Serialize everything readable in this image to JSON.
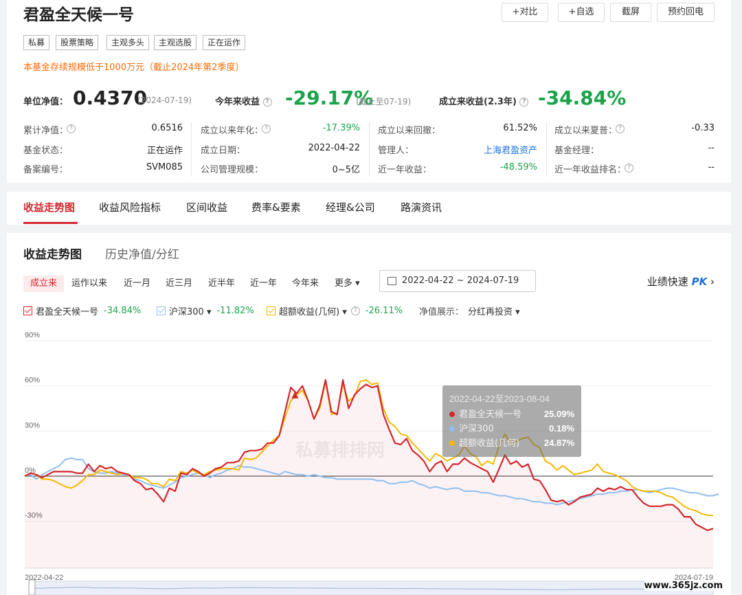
{
  "header": {
    "title": "君盈全天候一号",
    "buttons": [
      "+对比",
      "+自选",
      "截屏",
      "预约回电"
    ],
    "tags": [
      "私募",
      "股票策略",
      "主观多头",
      "主观选股",
      "正在运作"
    ],
    "notice": "本基金存续规模低于1000万元（截止2024年第2季度）"
  },
  "metrics": {
    "nav_label": "单位净值：",
    "nav_value": "0.4370",
    "nav_date": "(2024-07-19)",
    "ytd_label": "今年来收益",
    "ytd_value": "-29.17%",
    "ytd_note": "(截止至07-19)",
    "since_label": "成立来收益(2.3年)",
    "since_value": "-34.84%"
  },
  "details": [
    [
      {
        "label": "累计净值：",
        "value": "0.6516",
        "help": true
      },
      {
        "label": "成立以来年化：",
        "value": "-17.39%",
        "help": true,
        "color": "#1aa34a"
      },
      {
        "label": "成立以来回撤：",
        "value": "61.52%"
      },
      {
        "label": "成立以来夏普：",
        "value": "-0.33",
        "help": true
      }
    ],
    [
      {
        "label": "基金状态：",
        "value": "正在运作"
      },
      {
        "label": "成立日期：",
        "value": "2022-04-22"
      },
      {
        "label": "管理人：",
        "value": "上海君盈资产",
        "color": "#1e6fd9"
      },
      {
        "label": "基金经理：",
        "value": "--"
      }
    ],
    [
      {
        "label": "备案编号：",
        "value": "SVM085"
      },
      {
        "label": "公司管理规模：",
        "value": "0~5亿"
      },
      {
        "label": "近一年收益：",
        "value": "-48.59%",
        "color": "#1aa34a"
      },
      {
        "label": "近一年收益排名：",
        "value": "--",
        "help": true
      }
    ]
  ],
  "tabs": [
    "收益走势图",
    "收益风险指标",
    "区间收益",
    "费率&要素",
    "经理&公司",
    "路演资讯"
  ],
  "chart_section": {
    "title": "收益走势图",
    "alt_title": "历史净值/分红",
    "ranges": [
      "成立来",
      "运作以来",
      "近一月",
      "近三月",
      "近半年",
      "近一年",
      "今年来",
      "更多 ▾"
    ],
    "date_range": "2022-04-22 ~ 2024-07-19",
    "pk_label": "业绩快速",
    "pk_brand": "PK",
    "legend": [
      {
        "name": "君盈全天候一号",
        "value": "-34.84%",
        "color": "#d3262d"
      },
      {
        "name": "沪深300 ▾",
        "value": "-11.82%",
        "color": "#8fbff0"
      },
      {
        "name": "超额收益(几何) ▾",
        "value": "-26.11%",
        "color": "#f5b800"
      }
    ],
    "nav_display_label": "净值展示：",
    "nav_display_value": "分红再投资 ▾",
    "watermark": "www.365jz.com"
  },
  "chart_data": {
    "type": "line",
    "title": "",
    "x_start_label": "2022-04-22",
    "x_end_label": "2024-07-19",
    "yticks": [
      "90%",
      "60%",
      "30%",
      "0%",
      "-30%"
    ],
    "ylim": [
      -50,
      90
    ],
    "series": [
      {
        "name": "君盈全天候一号",
        "color": "#d3262d",
        "values": [
          0,
          2,
          1,
          -1,
          1,
          3,
          3,
          3,
          3,
          2,
          2,
          8,
          3,
          7,
          5,
          6,
          3,
          2,
          1,
          -3,
          -5,
          -9,
          -8,
          -12,
          -17,
          -8,
          -10,
          2,
          1,
          5,
          3,
          0,
          2,
          5,
          6,
          9,
          9,
          10,
          16,
          17,
          17,
          18,
          22,
          22,
          27,
          43,
          59,
          55,
          60,
          50,
          38,
          47,
          64,
          43,
          41,
          64,
          45,
          54,
          58,
          61,
          59,
          60,
          41,
          31,
          22,
          21,
          25,
          17,
          14,
          10,
          3,
          8,
          10,
          3,
          8,
          8,
          12,
          9,
          7,
          5,
          3,
          -4,
          5,
          14,
          8,
          10,
          6,
          8,
          -2,
          -3,
          -9,
          -16,
          -17,
          -16,
          -19,
          -17,
          -14,
          -13,
          -12,
          -8,
          -10,
          -8,
          -9,
          -7,
          -9,
          -9,
          -14,
          -18,
          -20,
          -20,
          -20,
          -19,
          -19,
          -22,
          -27,
          -27,
          -32,
          -34,
          -36,
          -34.84
        ]
      },
      {
        "name": "沪深300",
        "color": "#8fbff0",
        "values": [
          0,
          1,
          -2,
          1,
          3,
          5,
          7,
          11,
          12,
          11,
          11,
          5,
          3,
          2,
          2,
          3,
          2,
          1,
          1,
          -2,
          -3,
          -5,
          -6,
          -7,
          -8,
          -6,
          -4,
          -1,
          0,
          1,
          2,
          1,
          -1,
          1,
          2,
          4,
          5,
          7,
          6,
          6,
          5,
          4,
          3,
          2,
          1,
          3,
          2,
          1,
          1,
          0,
          1,
          0,
          -1,
          -1,
          -2,
          -2,
          -2,
          -2,
          -2,
          -2,
          -2,
          -3,
          -3,
          -5,
          -5,
          -4,
          -4,
          -3,
          -5,
          -6,
          -8,
          -7,
          -8,
          -9,
          -8,
          -8,
          -10,
          -10,
          -10,
          -11,
          -11,
          -12,
          -13,
          -13,
          -14,
          -15,
          -15,
          -16,
          -17,
          -17,
          -18,
          -18,
          -19,
          -18,
          -17,
          -16,
          -15,
          -14,
          -13,
          -12,
          -12,
          -11,
          -11,
          -10,
          -10,
          -9,
          -9,
          -10,
          -11,
          -10,
          -9,
          -8,
          -8,
          -9,
          -10,
          -11,
          -11,
          -12,
          -13,
          -13,
          -11.82
        ]
      },
      {
        "name": "超额收益(几何)",
        "color": "#f5b800",
        "values": [
          0,
          2,
          1,
          -2,
          -2,
          -3,
          -5,
          -7,
          -8,
          -6,
          -3,
          1,
          1,
          4,
          3,
          2,
          1,
          2,
          1,
          -1,
          -1,
          -2,
          -5,
          -5,
          -7,
          -2,
          -3,
          3,
          2,
          4,
          2,
          1,
          3,
          4,
          5,
          5,
          5,
          4,
          12,
          11,
          12,
          16,
          20,
          24,
          27,
          39,
          50,
          54,
          57,
          50,
          38,
          45,
          63,
          41,
          42,
          61,
          50,
          53,
          63,
          64,
          61,
          62,
          45,
          36,
          33,
          28,
          27,
          22,
          18,
          14,
          10,
          15,
          13,
          10,
          12,
          14,
          20,
          15,
          13,
          7,
          10,
          8,
          20,
          28,
          22,
          23,
          25,
          26,
          21,
          19,
          10,
          8,
          4,
          7,
          4,
          1,
          2,
          3,
          4,
          8,
          3,
          2,
          1,
          -1,
          -3,
          -7,
          -9,
          -10,
          -10,
          -10,
          -11,
          -13,
          -14,
          -17,
          -20,
          -22,
          -23,
          -25,
          -26,
          -26.11
        ]
      }
    ],
    "tooltip": {
      "title": "2022-04-22至2023-08-04",
      "rows": [
        {
          "name": "君盈全天候一号",
          "value": "25.09%",
          "color": "#d3262d"
        },
        {
          "name": "沪深300",
          "value": "0.18%",
          "color": "#8fbff0"
        },
        {
          "name": "超额收益(几何)",
          "value": "24.87%",
          "color": "#f5b800"
        }
      ]
    },
    "watermark_text": "私募排排网"
  }
}
